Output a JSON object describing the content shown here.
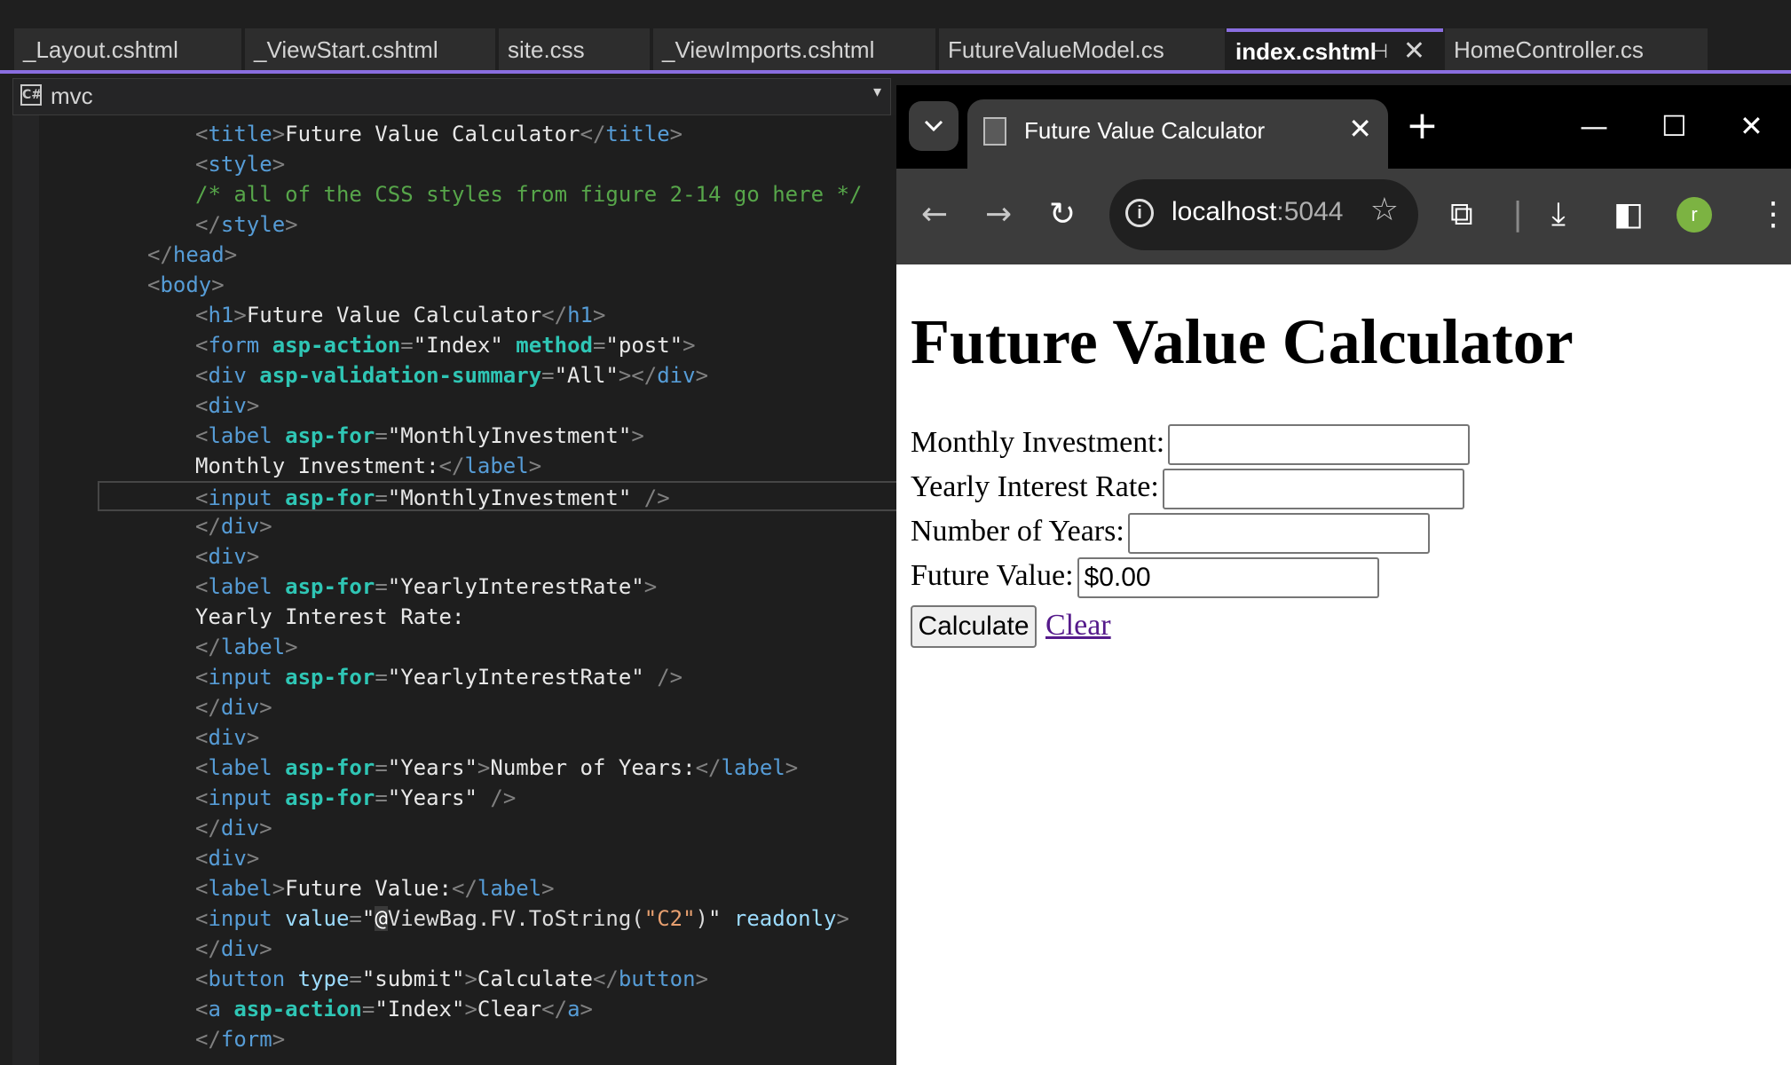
{
  "vs": {
    "tabs": [
      {
        "label": "_Layout.cshtml",
        "active": false
      },
      {
        "label": "_ViewStart.cshtml",
        "active": false
      },
      {
        "label": "site.css",
        "active": false
      },
      {
        "label": "_ViewImports.cshtml",
        "active": false
      },
      {
        "label": "FutureValueModel.cs",
        "active": false
      },
      {
        "label": "index.cshtml",
        "active": true
      },
      {
        "label": "HomeController.cs",
        "active": false
      }
    ],
    "nav_project": "mvc",
    "code": {
      "l1_tag": "title",
      "l1_text": "Future Value Calculator",
      "l2_tag": "style",
      "l3_comment": "/* all of the CSS styles from figure 2-14 go here */",
      "l5_tag": "head",
      "l6_tag": "body",
      "l7_tag": "h1",
      "l7_text": "Future Value Calculator",
      "l8_tag": "form",
      "l8_attr1": "asp-action",
      "l8_val1": "\"Index\"",
      "l8_attr2": "method",
      "l8_val2": "\"post\"",
      "l9_tag": "div",
      "l9_attr": "asp-validation-summary",
      "l9_val": "\"All\"",
      "div_tag": "div",
      "label_tag": "label",
      "input_tag": "input",
      "asp_for": "asp-for",
      "l11_val": "\"MonthlyInvestment\"",
      "l12_text": "Monthly Investment:",
      "l13_val": "\"MonthlyInvestment\"",
      "l16_val": "\"YearlyInterestRate\"",
      "l17_text": "Yearly Interest Rate:",
      "l19_val": "\"YearlyInterestRate\"",
      "l22_val": "\"Years\"",
      "l22_text": "Number of Years:",
      "l23_val": "\"Years\"",
      "l26_text": "Future Value:",
      "l27_attr1": "value",
      "l27_q": "\"",
      "l27_razor": "@",
      "l27_expr": "ViewBag.FV.ToString(",
      "l27_fmt": "\"C2\"",
      "l27_close": ")",
      "l27_attr2": "readonly",
      "l29_tag": "button",
      "l29_attr": "type",
      "l29_val": "\"submit\"",
      "l29_text": "Calculate",
      "l30_tag": "a",
      "l30_attr": "asp-action",
      "l30_val": "\"Index\"",
      "l30_text": "Clear",
      "l31_tag": "form"
    }
  },
  "browser": {
    "tab_title": "Future Value Calculator",
    "url_host": "localhost",
    "url_port": ":5044",
    "avatar_letter": "r",
    "page": {
      "heading": "Future Value Calculator",
      "monthly_label": "Monthly Investment:",
      "monthly_value": "",
      "rate_label": "Yearly Interest Rate:",
      "rate_value": "",
      "years_label": "Number of Years:",
      "years_value": "",
      "fv_label": "Future Value:",
      "fv_value": "$0.00",
      "calculate_label": "Calculate",
      "clear_label": "Clear"
    }
  },
  "colors": {
    "accent": "#8a6ee0",
    "tag": "#569cd6",
    "attribute": "#2fc6b5",
    "comment": "#57a64a",
    "visited_link": "#551a8b",
    "avatar": "#7cb342"
  }
}
